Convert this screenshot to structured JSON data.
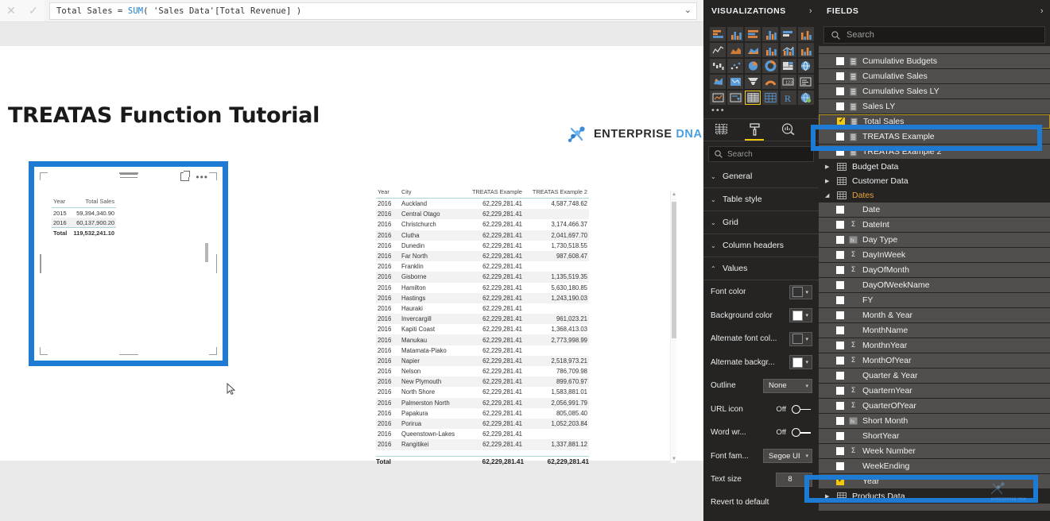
{
  "formula_bar": {
    "cancel_icon": "close-icon",
    "commit_icon": "check-icon",
    "formula_prefix": "Total Sales = ",
    "formula_keyword": "SUM",
    "formula_suffix": "( 'Sales Data'[Total Revenue] )",
    "expand_icon": "chevron-down-icon"
  },
  "report": {
    "title": "TREATAS Function Tutorial",
    "logo": {
      "primary": "ENTERPRISE",
      "secondary": "DNA",
      "icon": "dna-helix-icon"
    }
  },
  "selected_visual": {
    "focus_icon": "focus-mode-icon",
    "more_icon": "more-options-icon",
    "columns": [
      "Year",
      "Total Sales"
    ],
    "rows": [
      {
        "year": "2015",
        "total_sales": "59,394,340.90"
      },
      {
        "year": "2016",
        "total_sales": "60,137,900.20"
      }
    ],
    "total_label": "Total",
    "total_value": "119,532,241.10"
  },
  "main_table": {
    "columns": [
      "Year",
      "City",
      "TREATAS Example",
      "TREATAS Example 2"
    ],
    "rows": [
      {
        "year": "2016",
        "city": "Auckland",
        "ex1": "62,229,281.41",
        "ex2": "4,587,748.62"
      },
      {
        "year": "2016",
        "city": "Central Otago",
        "ex1": "62,229,281.41",
        "ex2": ""
      },
      {
        "year": "2016",
        "city": "Christchurch",
        "ex1": "62,229,281.41",
        "ex2": "3,174,466.37"
      },
      {
        "year": "2016",
        "city": "Clutha",
        "ex1": "62,229,281.41",
        "ex2": "2,041,697.70"
      },
      {
        "year": "2016",
        "city": "Dunedin",
        "ex1": "62,229,281.41",
        "ex2": "1,730,518.55"
      },
      {
        "year": "2016",
        "city": "Far North",
        "ex1": "62,229,281.41",
        "ex2": "987,608.47"
      },
      {
        "year": "2016",
        "city": "Franklin",
        "ex1": "62,229,281.41",
        "ex2": ""
      },
      {
        "year": "2016",
        "city": "Gisborne",
        "ex1": "62,229,281.41",
        "ex2": "1,135,519.35"
      },
      {
        "year": "2016",
        "city": "Hamilton",
        "ex1": "62,229,281.41",
        "ex2": "5,630,180.85"
      },
      {
        "year": "2016",
        "city": "Hastings",
        "ex1": "62,229,281.41",
        "ex2": "1,243,190.03"
      },
      {
        "year": "2016",
        "city": "Hauraki",
        "ex1": "62,229,281.41",
        "ex2": ""
      },
      {
        "year": "2016",
        "city": "Invercargill",
        "ex1": "62,229,281.41",
        "ex2": "961,023.21"
      },
      {
        "year": "2016",
        "city": "Kapiti Coast",
        "ex1": "62,229,281.41",
        "ex2": "1,368,413.03"
      },
      {
        "year": "2016",
        "city": "Manukau",
        "ex1": "62,229,281.41",
        "ex2": "2,773,998.99"
      },
      {
        "year": "2016",
        "city": "Matamata-Piako",
        "ex1": "62,229,281.41",
        "ex2": ""
      },
      {
        "year": "2016",
        "city": "Napier",
        "ex1": "62,229,281.41",
        "ex2": "2,518,973.21"
      },
      {
        "year": "2016",
        "city": "Nelson",
        "ex1": "62,229,281.41",
        "ex2": "786,709.98"
      },
      {
        "year": "2016",
        "city": "New Plymouth",
        "ex1": "62,229,281.41",
        "ex2": "899,670.97"
      },
      {
        "year": "2016",
        "city": "North Shore",
        "ex1": "62,229,281.41",
        "ex2": "1,583,881.01"
      },
      {
        "year": "2016",
        "city": "Palmerston North",
        "ex1": "62,229,281.41",
        "ex2": "2,056,991.79"
      },
      {
        "year": "2016",
        "city": "Papakura",
        "ex1": "62,229,281.41",
        "ex2": "805,085.40"
      },
      {
        "year": "2016",
        "city": "Porirua",
        "ex1": "62,229,281.41",
        "ex2": "1,052,203.84"
      },
      {
        "year": "2016",
        "city": "Queenstown-Lakes",
        "ex1": "62,229,281.41",
        "ex2": ""
      },
      {
        "year": "2016",
        "city": "Rangitikei",
        "ex1": "62,229,281.41",
        "ex2": "1,337,881.12"
      }
    ],
    "total_label": "Total",
    "total_ex1": "62,229,281.41",
    "total_ex2": "62,229,281.41"
  },
  "visualizations": {
    "header": "VISUALIZATIONS",
    "expand_icon": "chevron-right-icon",
    "more_icon": "more-visuals-icon",
    "selected_visual_type": "table",
    "tabs": [
      {
        "name": "fields-tab",
        "icon": "fields-grid-icon",
        "active": false
      },
      {
        "name": "format-tab",
        "icon": "paint-roller-icon",
        "active": true
      },
      {
        "name": "analytics-tab",
        "icon": "magnifier-chart-icon",
        "active": false
      }
    ],
    "search_placeholder": "Search",
    "sections": [
      {
        "label": "General",
        "expanded": false
      },
      {
        "label": "Table style",
        "expanded": false
      },
      {
        "label": "Grid",
        "expanded": false
      },
      {
        "label": "Column headers",
        "expanded": false
      },
      {
        "label": "Values",
        "expanded": true
      }
    ],
    "values_settings": {
      "font_color": {
        "label": "Font color",
        "value": "#333333"
      },
      "background_color": {
        "label": "Background color",
        "value": "#ffffff"
      },
      "alternate_font_color": {
        "label": "Alternate font col...",
        "value": "#333333"
      },
      "alternate_background": {
        "label": "Alternate backgr...",
        "value": "#ffffff"
      },
      "outline": {
        "label": "Outline",
        "value": "None"
      },
      "url_icon": {
        "label": "URL icon",
        "value": "Off"
      },
      "word_wrap": {
        "label": "Word wr...",
        "value": "Off"
      },
      "font_family": {
        "label": "Font fam...",
        "value": "Segoe UI"
      },
      "text_size": {
        "label": "Text size",
        "value": "8"
      }
    },
    "revert": "Revert to default"
  },
  "fields": {
    "header": "FIELDS",
    "expand_icon": "chevron-right-icon",
    "search_placeholder": "Search",
    "measures": [
      {
        "label": "Cumulative Budgets",
        "checked": false,
        "icon": "measure-icon"
      },
      {
        "label": "Cumulative Sales",
        "checked": false,
        "icon": "measure-icon"
      },
      {
        "label": "Cumulative Sales LY",
        "checked": false,
        "icon": "measure-icon"
      },
      {
        "label": "Sales LY",
        "checked": false,
        "icon": "measure-icon"
      },
      {
        "label": "Total Sales",
        "checked": true,
        "icon": "measure-icon",
        "selected": true
      },
      {
        "label": "TREATAS Example",
        "checked": false,
        "icon": "measure-icon"
      },
      {
        "label": "TREATAS Example 2",
        "checked": false,
        "icon": "measure-icon"
      }
    ],
    "tables": [
      {
        "label": "Budget Data",
        "expanded": false
      },
      {
        "label": "Customer Data",
        "expanded": false
      },
      {
        "label": "Dates",
        "expanded": true
      }
    ],
    "dates_fields": [
      {
        "label": "Date",
        "checked": false,
        "type": "text"
      },
      {
        "label": "DateInt",
        "checked": false,
        "type": "sum"
      },
      {
        "label": "Day Type",
        "checked": false,
        "type": "calc"
      },
      {
        "label": "DayInWeek",
        "checked": false,
        "type": "sum"
      },
      {
        "label": "DayOfMonth",
        "checked": false,
        "type": "sum"
      },
      {
        "label": "DayOfWeekName",
        "checked": false,
        "type": "text"
      },
      {
        "label": "FY",
        "checked": false,
        "type": "text"
      },
      {
        "label": "Month & Year",
        "checked": false,
        "type": "text"
      },
      {
        "label": "MonthName",
        "checked": false,
        "type": "text"
      },
      {
        "label": "MonthnYear",
        "checked": false,
        "type": "sum"
      },
      {
        "label": "MonthOfYear",
        "checked": false,
        "type": "sum"
      },
      {
        "label": "Quarter & Year",
        "checked": false,
        "type": "text"
      },
      {
        "label": "QuarternYear",
        "checked": false,
        "type": "sum"
      },
      {
        "label": "QuarterOfYear",
        "checked": false,
        "type": "sum"
      },
      {
        "label": "Short Month",
        "checked": false,
        "type": "calc"
      },
      {
        "label": "ShortYear",
        "checked": false,
        "type": "text"
      },
      {
        "label": "Week Number",
        "checked": false,
        "type": "sum"
      },
      {
        "label": "WeekEnding",
        "checked": false,
        "type": "text"
      },
      {
        "label": "Year",
        "checked": true,
        "type": "text"
      }
    ],
    "tables_after": [
      {
        "label": "Products Data",
        "expanded": false
      }
    ]
  },
  "annotations": {
    "accent_color": "#1e7bd3"
  }
}
